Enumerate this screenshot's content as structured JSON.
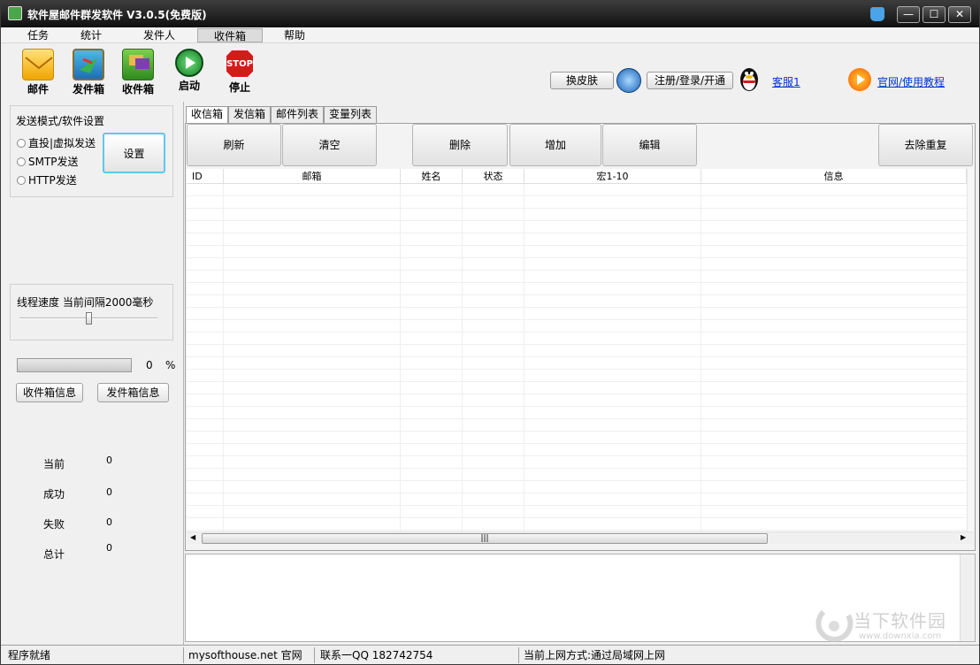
{
  "window": {
    "title": "软件屋邮件群发软件 V3.0.5(免费版)",
    "minimize": "—",
    "maximize": "☐",
    "close": "✕"
  },
  "menu": [
    "任务",
    "统计",
    "发件人",
    "收件箱",
    "帮助"
  ],
  "toolbar": {
    "tools": [
      {
        "label": "邮件",
        "icon": "envelope-icon"
      },
      {
        "label": "发件箱",
        "icon": "outbox-icon"
      },
      {
        "label": "收件箱",
        "icon": "inbox-icon"
      },
      {
        "label": "启动",
        "icon": "start-icon"
      },
      {
        "label": "停止",
        "icon": "stop-icon"
      }
    ],
    "stop_sign_text": "STOP",
    "skin_button": "换皮肤",
    "register_button": "注册/登录/开通",
    "support_link": "客服1",
    "tutorial_link": "官网/使用教程"
  },
  "left": {
    "settings_title": "发送模式/软件设置",
    "modes": [
      "直投|虚拟发送",
      "SMTP发送",
      "HTTP发送"
    ],
    "settings_button": "设置",
    "speed_label": "线程速度  当前间隔2000毫秒",
    "progress_value": "0",
    "progress_unit": "%",
    "progress_fraction": 0,
    "inbox_info_button": "收件箱信息",
    "outbox_info_button": "发件箱信息",
    "stats": [
      {
        "label": "当前",
        "value": "0"
      },
      {
        "label": "成功",
        "value": "0"
      },
      {
        "label": "失败",
        "value": "0"
      },
      {
        "label": "总计",
        "value": "0"
      }
    ]
  },
  "tabs": [
    "收信箱",
    "发信箱",
    "邮件列表",
    "变量列表"
  ],
  "actions": {
    "refresh": "刷新",
    "clear": "清空",
    "delete": "删除",
    "add": "增加",
    "edit": "编辑",
    "dedupe": "去除重复"
  },
  "table": {
    "columns": [
      "ID",
      "邮箱",
      "姓名",
      "状态",
      "宏1-10",
      "信息"
    ],
    "hscroll_grip": "|||"
  },
  "status": {
    "ready": "程序就绪",
    "site": "mysofthouse.net 官网",
    "contact": "联系一QQ 182742754",
    "network": "当前上网方式:通过局域网上网"
  },
  "watermark": {
    "brand": "当下软件园",
    "url": "www.downxia.com"
  }
}
